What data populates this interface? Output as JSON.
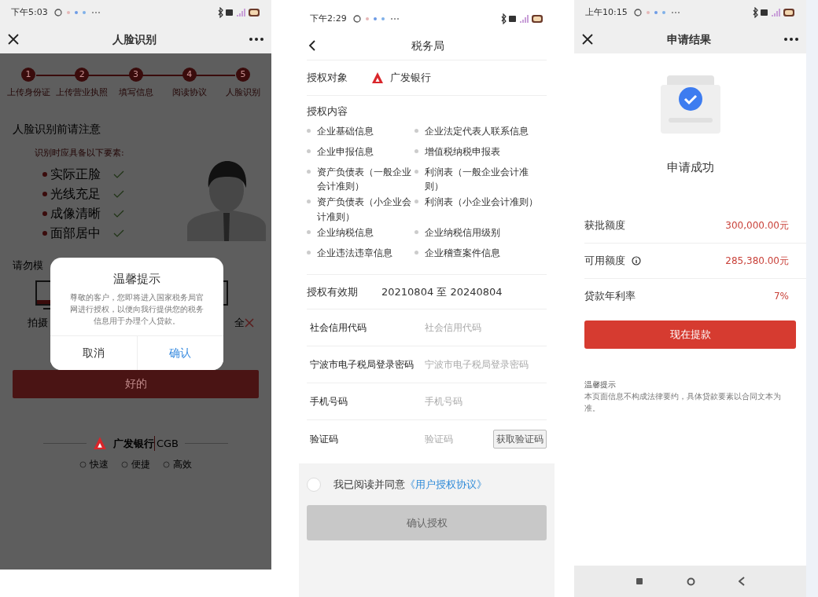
{
  "face_screen": {
    "status_time": "下午5:03",
    "title": "人脸识别",
    "steps": [
      {
        "number": "1",
        "label": "上传身份证"
      },
      {
        "number": "2",
        "label": "上传营业执照"
      },
      {
        "number": "3",
        "label": "填写信息"
      },
      {
        "number": "4",
        "label": "阅读协议"
      },
      {
        "number": "5",
        "label": "人脸识别"
      }
    ],
    "notice_heading": "人脸识别前请注意",
    "requirements_heading": "识别时应具备以下要素:",
    "requirements": [
      "实际正脸",
      "光线充足",
      "成像清晰",
      "面部居中"
    ],
    "warning_partial": "请勿模",
    "example_captions": [
      "拍摄",
      "全"
    ],
    "ok_button": "好的",
    "bank_name": "广发银行",
    "bank_code": "CGB",
    "features": [
      "快速",
      "便捷",
      "高效"
    ],
    "dialog": {
      "title": "温馨提示",
      "message": "尊敬的客户，您即将进入国家税务局官网进行授权，以便向我行提供您的税务信息用于办理个人贷款。",
      "buttons": [
        {
          "label": "取消",
          "kind": "cancel"
        },
        {
          "label": "确认",
          "kind": "confirm"
        }
      ]
    }
  },
  "tax_screen": {
    "status_time": "下午2:29",
    "title": "税务局",
    "grantee": {
      "label": "授权对象",
      "name": "广发银行"
    },
    "scope": {
      "label": "授权内容",
      "items": [
        "企业基础信息",
        "企业法定代表人联系信息",
        "企业申报信息",
        "增值税纳税申报表",
        "资产负债表（一般企业会计准则）",
        "利润表（一般企业会计准则）",
        "资产负债表（小企业会计准则）",
        "利润表（小企业会计准则）",
        "企业纳税信息",
        "企业纳税信用级别",
        "企业违法违章信息",
        "企业稽查案件信息"
      ]
    },
    "validity": {
      "label": "授权有效期",
      "value": "20210804 至 20240804"
    },
    "fields": [
      {
        "label": "社会信用代码",
        "placeholder": "社会信用代码"
      },
      {
        "label": "宁波市电子税局登录密码",
        "placeholder": "宁波市电子税局登录密码"
      },
      {
        "label": "手机号码",
        "placeholder": "手机号码"
      },
      {
        "label": "验证码",
        "placeholder": "验证码",
        "action": "获取验证码"
      }
    ],
    "agreement": {
      "checked": false,
      "text": "我已阅读并同意",
      "link": "《用户授权协议》"
    },
    "submit": {
      "label": "确认授权",
      "disabled": true
    }
  },
  "result_screen": {
    "status_time": "上午10:15",
    "title": "申请结果",
    "status": "申请成功",
    "details": [
      {
        "label": "获批额度",
        "value": "300,000.00元",
        "info": false
      },
      {
        "label": "可用额度",
        "value": "285,380.00元",
        "info": true
      },
      {
        "label": "贷款年利率",
        "value": "7%",
        "info": false
      }
    ],
    "withdraw_button": "现在提款",
    "tip_title": "温馨提示",
    "tip_text": "本页面信息不构成法律要约，具体贷款要素以合同文本为准。"
  }
}
